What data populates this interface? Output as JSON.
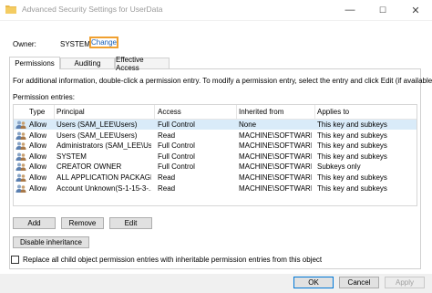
{
  "window": {
    "title": "Advanced Security Settings for UserData",
    "minimize": "—",
    "maximize": "☐",
    "close": "✕"
  },
  "owner": {
    "label": "Owner:",
    "value": "SYSTEM",
    "change_link": "Change"
  },
  "tabs": [
    {
      "label": "Permissions",
      "active": true
    },
    {
      "label": "Auditing",
      "active": false
    },
    {
      "label": "Effective Access",
      "active": false
    }
  ],
  "info_text": "For additional information, double-click a permission entry. To modify a permission entry, select the entry and click Edit (if available).",
  "entries_label": "Permission entries:",
  "table": {
    "headers": [
      "Type",
      "Principal",
      "Access",
      "Inherited from",
      "Applies to"
    ],
    "rows": [
      {
        "type": "Allow",
        "principal": "Users (SAM_LEE\\Users)",
        "access": "Full Control",
        "inherited": "None",
        "applies": "This key and subkeys",
        "selected": true
      },
      {
        "type": "Allow",
        "principal": "Users (SAM_LEE\\Users)",
        "access": "Read",
        "inherited": "MACHINE\\SOFTWARE...",
        "applies": "This key and subkeys",
        "selected": false
      },
      {
        "type": "Allow",
        "principal": "Administrators (SAM_LEE\\Users)",
        "access": "Full Control",
        "inherited": "MACHINE\\SOFTWARE...",
        "applies": "This key and subkeys",
        "selected": false
      },
      {
        "type": "Allow",
        "principal": "SYSTEM",
        "access": "Full Control",
        "inherited": "MACHINE\\SOFTWARE...",
        "applies": "This key and subkeys",
        "selected": false
      },
      {
        "type": "Allow",
        "principal": "CREATOR OWNER",
        "access": "Full Control",
        "inherited": "MACHINE\\SOFTWARE...",
        "applies": "Subkeys only",
        "selected": false
      },
      {
        "type": "Allow",
        "principal": "ALL APPLICATION PACKAGES",
        "access": "Read",
        "inherited": "MACHINE\\SOFTWARE...",
        "applies": "This key and subkeys",
        "selected": false
      },
      {
        "type": "Allow",
        "principal": "Account Unknown(S-1-15-3-...",
        "access": "Read",
        "inherited": "MACHINE\\SOFTWARE...",
        "applies": "This key and subkeys",
        "selected": false
      }
    ]
  },
  "buttons": {
    "add": "Add",
    "remove": "Remove",
    "edit": "Edit",
    "disable_inheritance": "Disable inheritance",
    "ok": "OK",
    "cancel": "Cancel",
    "apply": "Apply"
  },
  "replace_checkbox": {
    "label": "Replace all child object permission entries with inheritable permission entries from this object",
    "checked": false
  },
  "colors": {
    "accent": "#0078d7",
    "link": "#1a5fb4",
    "highlight_border": "#f0a030",
    "selection": "#d9ebf9"
  }
}
